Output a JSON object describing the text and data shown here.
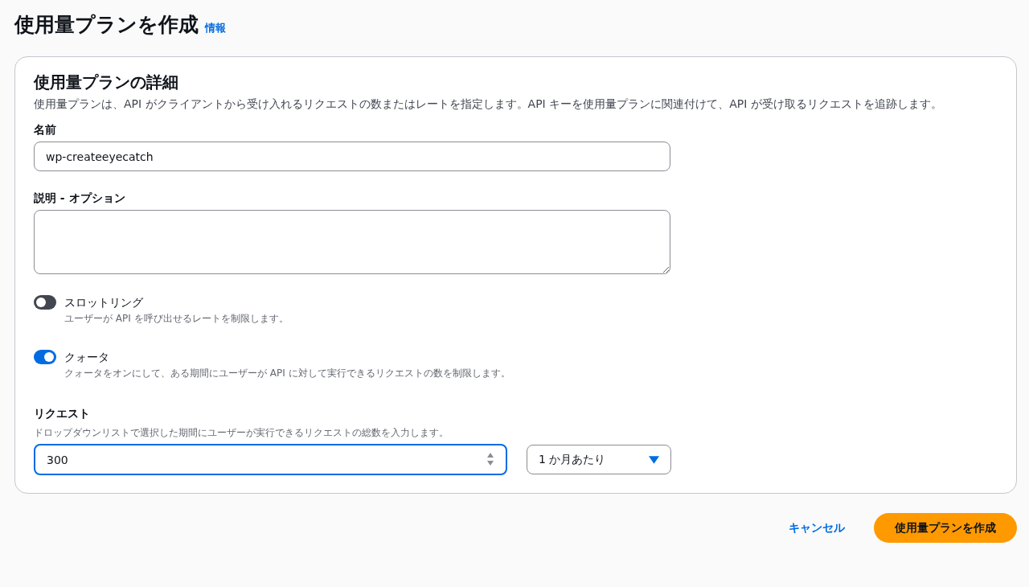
{
  "page": {
    "title": "使用量プランを作成",
    "info_link": "情報"
  },
  "panel": {
    "heading": "使用量プランの詳細",
    "description": "使用量プランは、API がクライアントから受け入れるリクエストの数またはレートを指定します。API キーを使用量プランに関連付けて、API が受け取るリクエストを追跡します。",
    "fields": [
      {
        "kind": "text",
        "label": "名前",
        "value": "wp-createeyecatch"
      },
      {
        "kind": "textarea",
        "label": "説明 - オプション"
      }
    ],
    "toggles": [
      {
        "label": "スロットリング",
        "description": "ユーザーが API を呼び出せるレートを制限します。",
        "on": false
      },
      {
        "label": "クォータ",
        "description": "クォータをオンにして、ある期間にユーザーが API に対して実行できるリクエストの数を制限します。",
        "on": true
      }
    ],
    "requests": {
      "label": "リクエスト",
      "description": "ドロップダウンリストで選択した期間にユーザーが実行できるリクエストの総数を入力します。",
      "value": "300",
      "period": "1 か月あたり"
    }
  },
  "actions": {
    "cancel": "キャンセル",
    "submit": "使用量プランを作成"
  }
}
